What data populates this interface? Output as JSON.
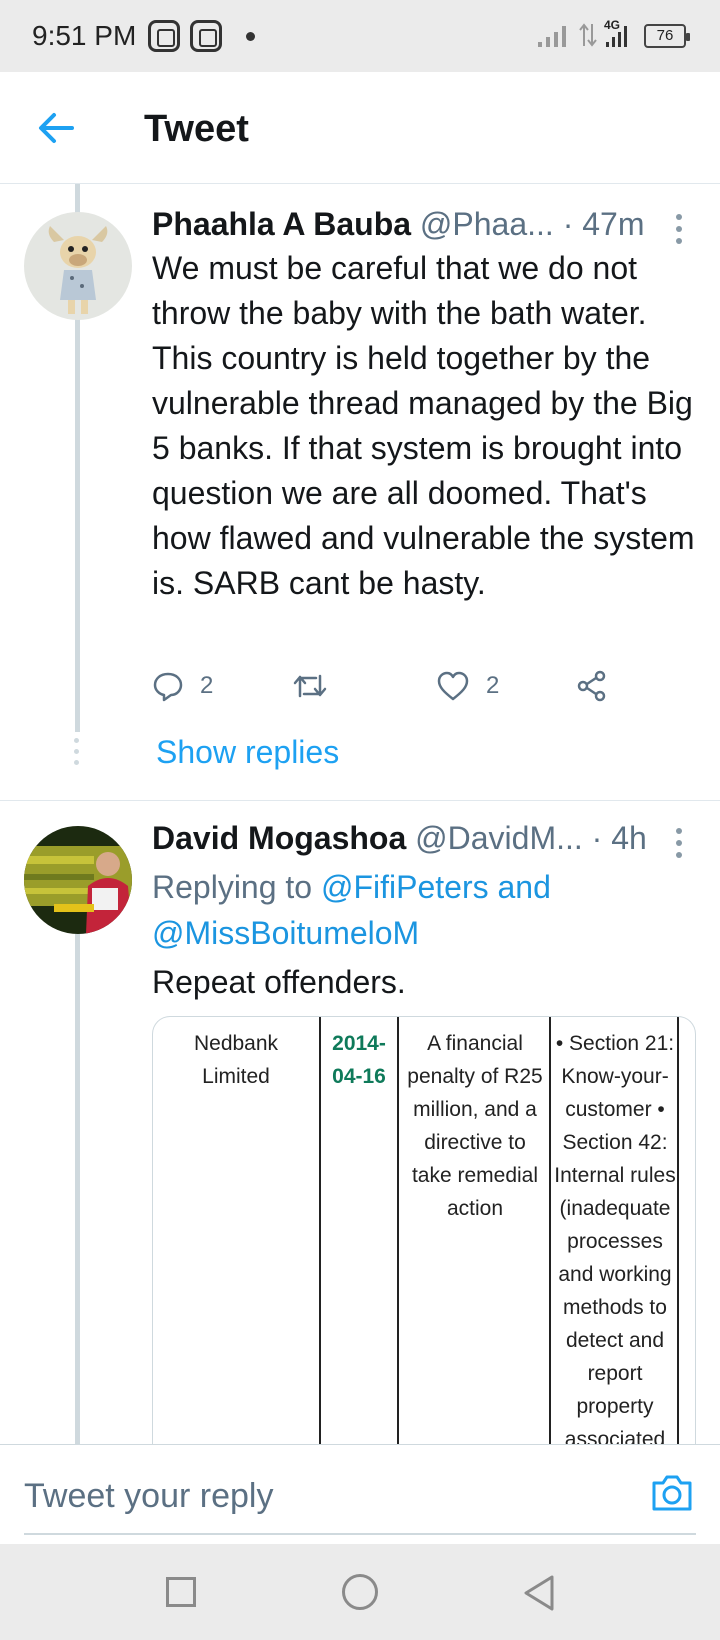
{
  "status_bar": {
    "time": "9:51 PM",
    "network": "4G",
    "battery": "76",
    "icons": [
      "app-notification-icon",
      "app-notification-icon",
      "dot-icon",
      "signal-icon",
      "data-arrows-icon",
      "signal-4g-icon",
      "battery-icon"
    ]
  },
  "header": {
    "back_icon": "arrow-left-icon",
    "title": "Tweet"
  },
  "tweets": [
    {
      "name": "Phaahla A Bauba",
      "handle": "@Phaa...",
      "time": "· 47m",
      "text": "We must be careful that we do not throw the baby with the bath water. This country is held together by the vulnerable thread managed by the Big 5 banks. If that system is brought into question we are all doomed. That's how flawed and vulnerable the system is. SARB cant be hasty.",
      "actions": {
        "reply_count": "2",
        "retweet_count": "",
        "like_count": "2"
      },
      "show_replies": "Show replies"
    },
    {
      "name": "David Mogashoa",
      "handle": "@DavidM...",
      "time": "· 4h",
      "replying_prefix": "Replying to ",
      "replying_mention_1": "@FifiPeters",
      "replying_and": " and",
      "replying_mention_2": "@MissBoitumeloM",
      "text": "Repeat offenders.",
      "media_table": {
        "bank": [
          "Nedbank",
          "Limited"
        ],
        "date": [
          "2014-",
          "04-16"
        ],
        "sanction": [
          "A financial",
          "penalty of R25",
          "million, and a",
          "directive to",
          "take remedial",
          "action"
        ],
        "breach": [
          "• Section 21:",
          "Know-your-",
          "customer •",
          "Section 42:",
          "Internal rules",
          "(inadequate",
          "processes",
          "and working",
          "methods to",
          "detect and",
          "report",
          "property",
          "associated"
        ]
      }
    }
  ],
  "reply_bar": {
    "placeholder": "Tweet your reply",
    "camera_icon": "camera-icon"
  },
  "nav_bar": {
    "icons": [
      "recents-square-icon",
      "home-circle-icon",
      "back-triangle-icon"
    ]
  },
  "colors": {
    "accent": "#1da1f2",
    "secondary_text": "#5b7083",
    "thread_line": "#cfd9de"
  }
}
